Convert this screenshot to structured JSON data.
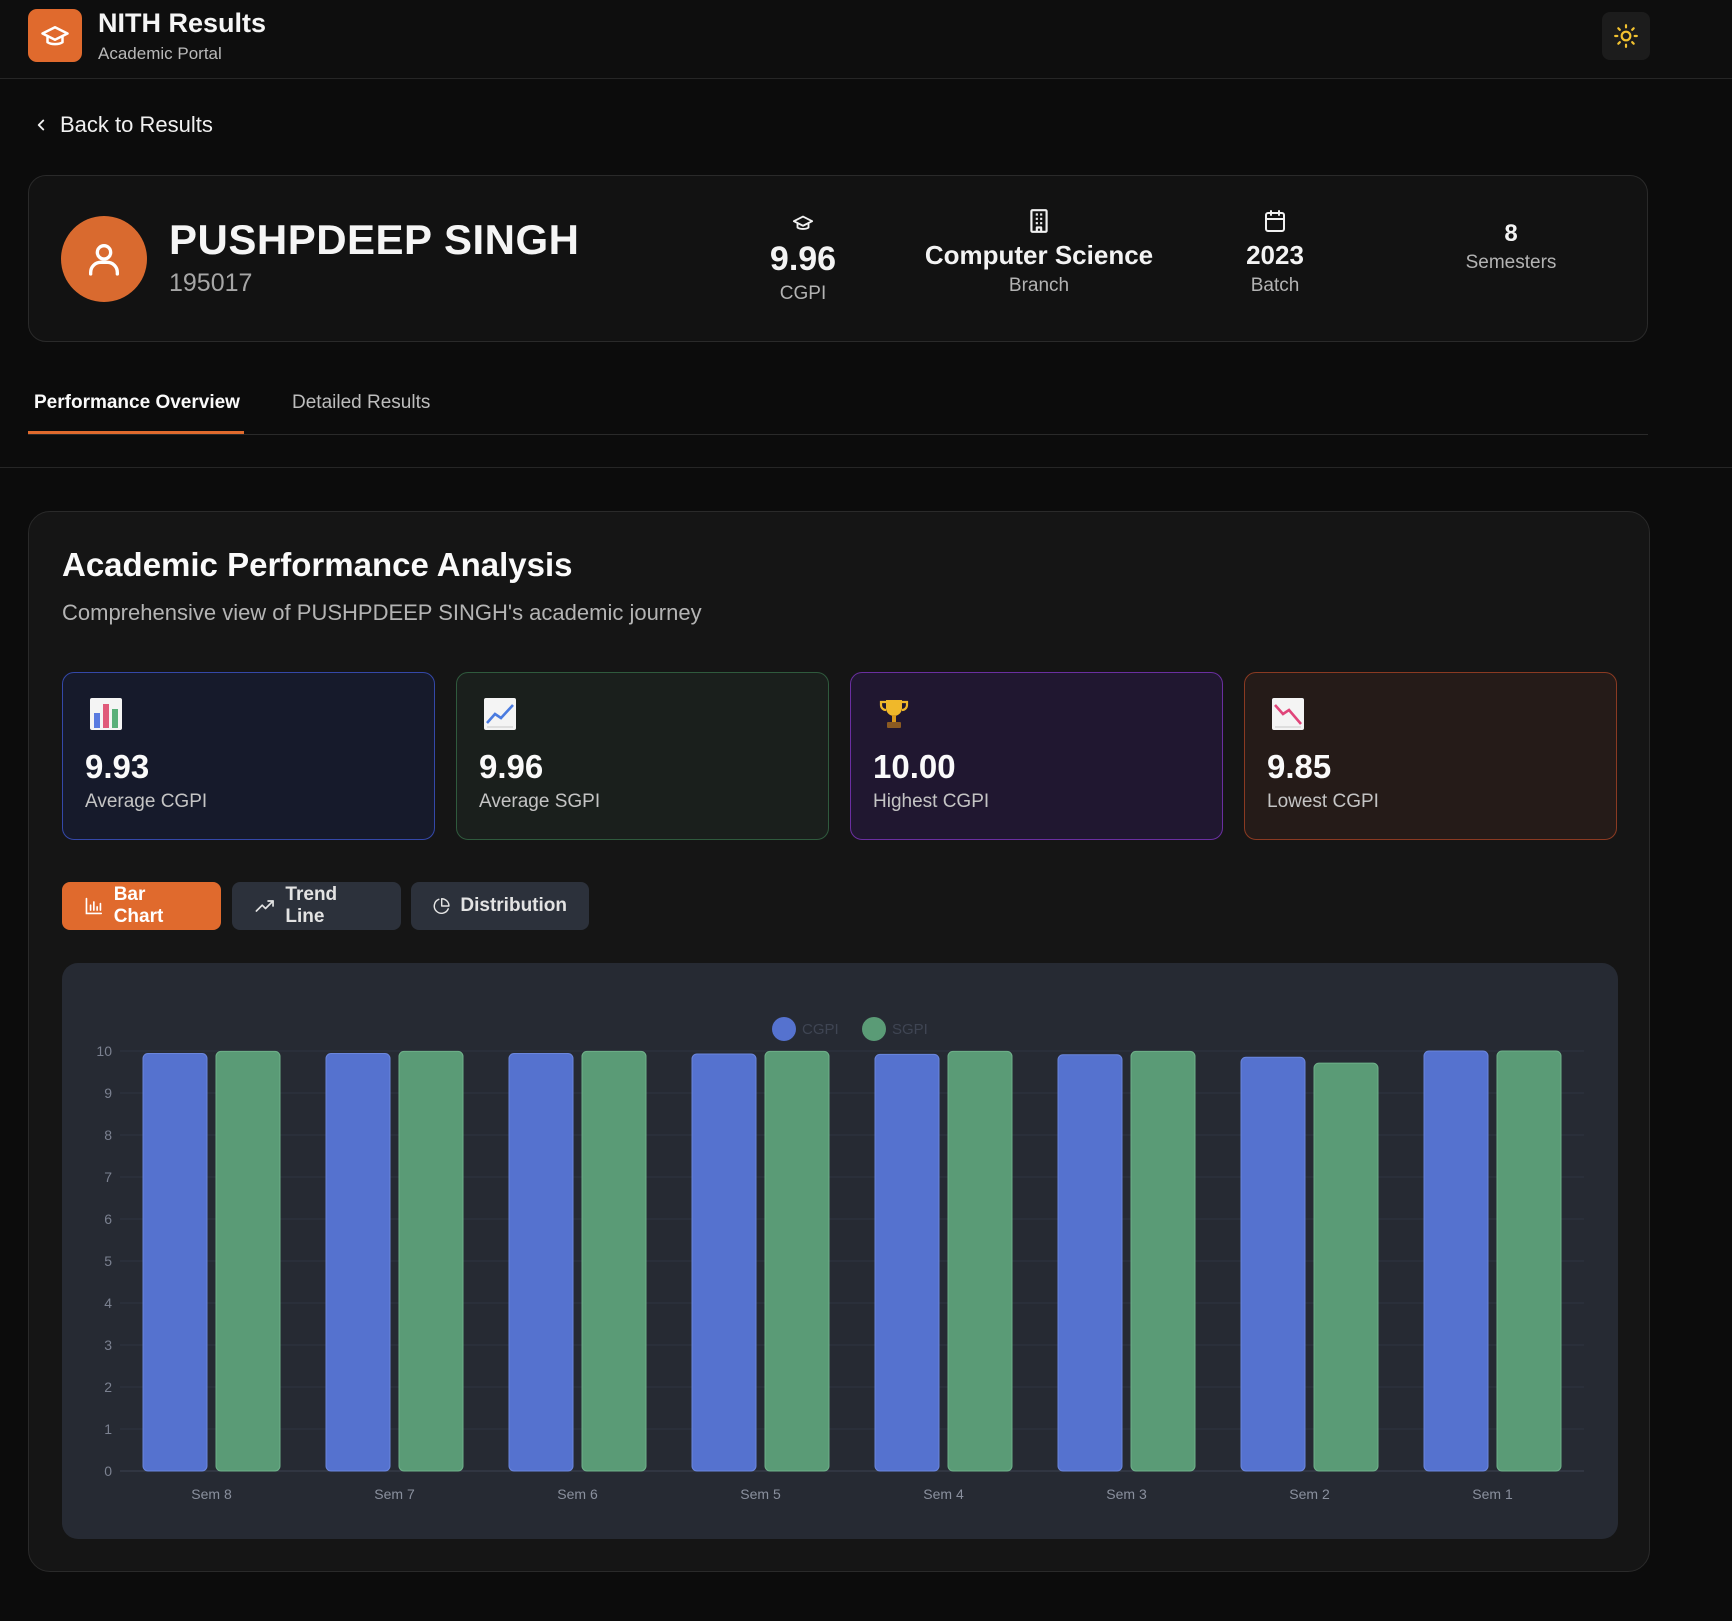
{
  "app": {
    "title": "NITH Results",
    "subtitle": "Academic Portal",
    "logo_icon": "graduation-cap-icon",
    "theme_icon": "sun-icon",
    "accent": "#e06a2d"
  },
  "nav": {
    "back_label": "Back to Results"
  },
  "student": {
    "name": "PUSHPDEEP SINGH",
    "roll": "195017",
    "stats": [
      {
        "icon": "graduation-cap-icon",
        "value": "9.96",
        "label": "CGPI"
      },
      {
        "icon": "building-icon",
        "value": "Computer Science",
        "label": "Branch"
      },
      {
        "icon": "calendar-icon",
        "value": "2023",
        "label": "Batch"
      },
      {
        "value": "8",
        "label": "Semesters"
      }
    ]
  },
  "tabs": [
    {
      "label": "Performance Overview",
      "active": true
    },
    {
      "label": "Detailed Results",
      "active": false
    }
  ],
  "analysis": {
    "title": "Academic Performance Analysis",
    "subtitle": "Comprehensive view of PUSHPDEEP SINGH's academic journey",
    "metrics": [
      {
        "icon": "bar-chart-emoji-icon",
        "value": "9.93",
        "label": "Average CGPI",
        "color": "#3448a8"
      },
      {
        "icon": "trend-up-emoji-icon",
        "value": "9.96",
        "label": "Average SGPI",
        "color": "#2f5a3d"
      },
      {
        "icon": "trophy-emoji-icon",
        "value": "10.00",
        "label": "Highest CGPI",
        "color": "#6a2fa0"
      },
      {
        "icon": "trend-down-emoji-icon",
        "value": "9.85",
        "label": "Lowest CGPI",
        "color": "#8a3a22"
      }
    ],
    "chart_buttons": [
      {
        "label": "Bar Chart",
        "icon": "bar-chart-icon",
        "active": true
      },
      {
        "label": "Trend Line",
        "icon": "trend-line-icon",
        "active": false
      },
      {
        "label": "Distribution",
        "icon": "pie-chart-icon",
        "active": false
      }
    ]
  },
  "chart_data": {
    "type": "bar",
    "categories": [
      "Sem 8",
      "Sem 7",
      "Sem 6",
      "Sem 5",
      "Sem 4",
      "Sem 3",
      "Sem 2",
      "Sem 1"
    ],
    "series": [
      {
        "name": "CGPI",
        "color": "#5572cf",
        "values": [
          9.94,
          9.94,
          9.94,
          9.93,
          9.92,
          9.91,
          9.85,
          10.0
        ]
      },
      {
        "name": "SGPI",
        "color": "#5a9b76",
        "values": [
          9.99,
          9.99,
          9.99,
          9.99,
          9.99,
          9.99,
          9.71,
          10.0
        ]
      }
    ],
    "ylim": [
      0,
      10
    ],
    "yticks": [
      "0",
      "1",
      "2",
      "3",
      "4",
      "5",
      "6",
      "7",
      "8",
      "9",
      "10"
    ],
    "grid": true,
    "legend_position": "top-center"
  }
}
